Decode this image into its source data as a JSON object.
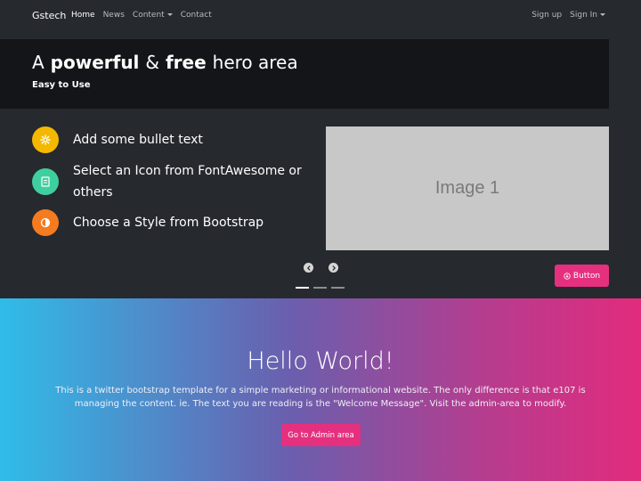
{
  "navbar": {
    "brand": "Gstech",
    "items": [
      {
        "label": "Home",
        "active": true
      },
      {
        "label": "News"
      },
      {
        "label": "Content",
        "dropdown": true
      },
      {
        "label": "Contact"
      }
    ],
    "signup": "Sign up",
    "signin": "Sign In"
  },
  "hero": {
    "title_a": "A",
    "title_b": "powerful",
    "title_c": "&",
    "title_d": "free",
    "title_e": "hero area",
    "subtitle": "Easy to Use"
  },
  "bullets": [
    {
      "text": "Add some bullet text",
      "icon": "gear-icon",
      "color": "#f5b800"
    },
    {
      "text": "Select an Icon from FontAwesome or others",
      "icon": "file-icon",
      "color": "#3fcf9f"
    },
    {
      "text": "Choose a Style from Bootstrap",
      "icon": "half-circle-icon",
      "color": "#f47b20"
    }
  ],
  "carousel": {
    "slide_label": "Image 1",
    "active_index": 0,
    "slide_count": 3
  },
  "hero_button": "Button",
  "welcome": {
    "title": "Hello World!",
    "text": "This is a twitter bootstrap template for a simple marketing or informational website. The only difference is that e107 is managing the content. ie. The text you are reading is the \"Welcome Message\". Visit the admin-area to modify.",
    "button": "Go to Admin area"
  },
  "colors": {
    "accent": "#e5307f",
    "navbar_bg": "#26292e",
    "hero_head_bg": "#131518"
  }
}
